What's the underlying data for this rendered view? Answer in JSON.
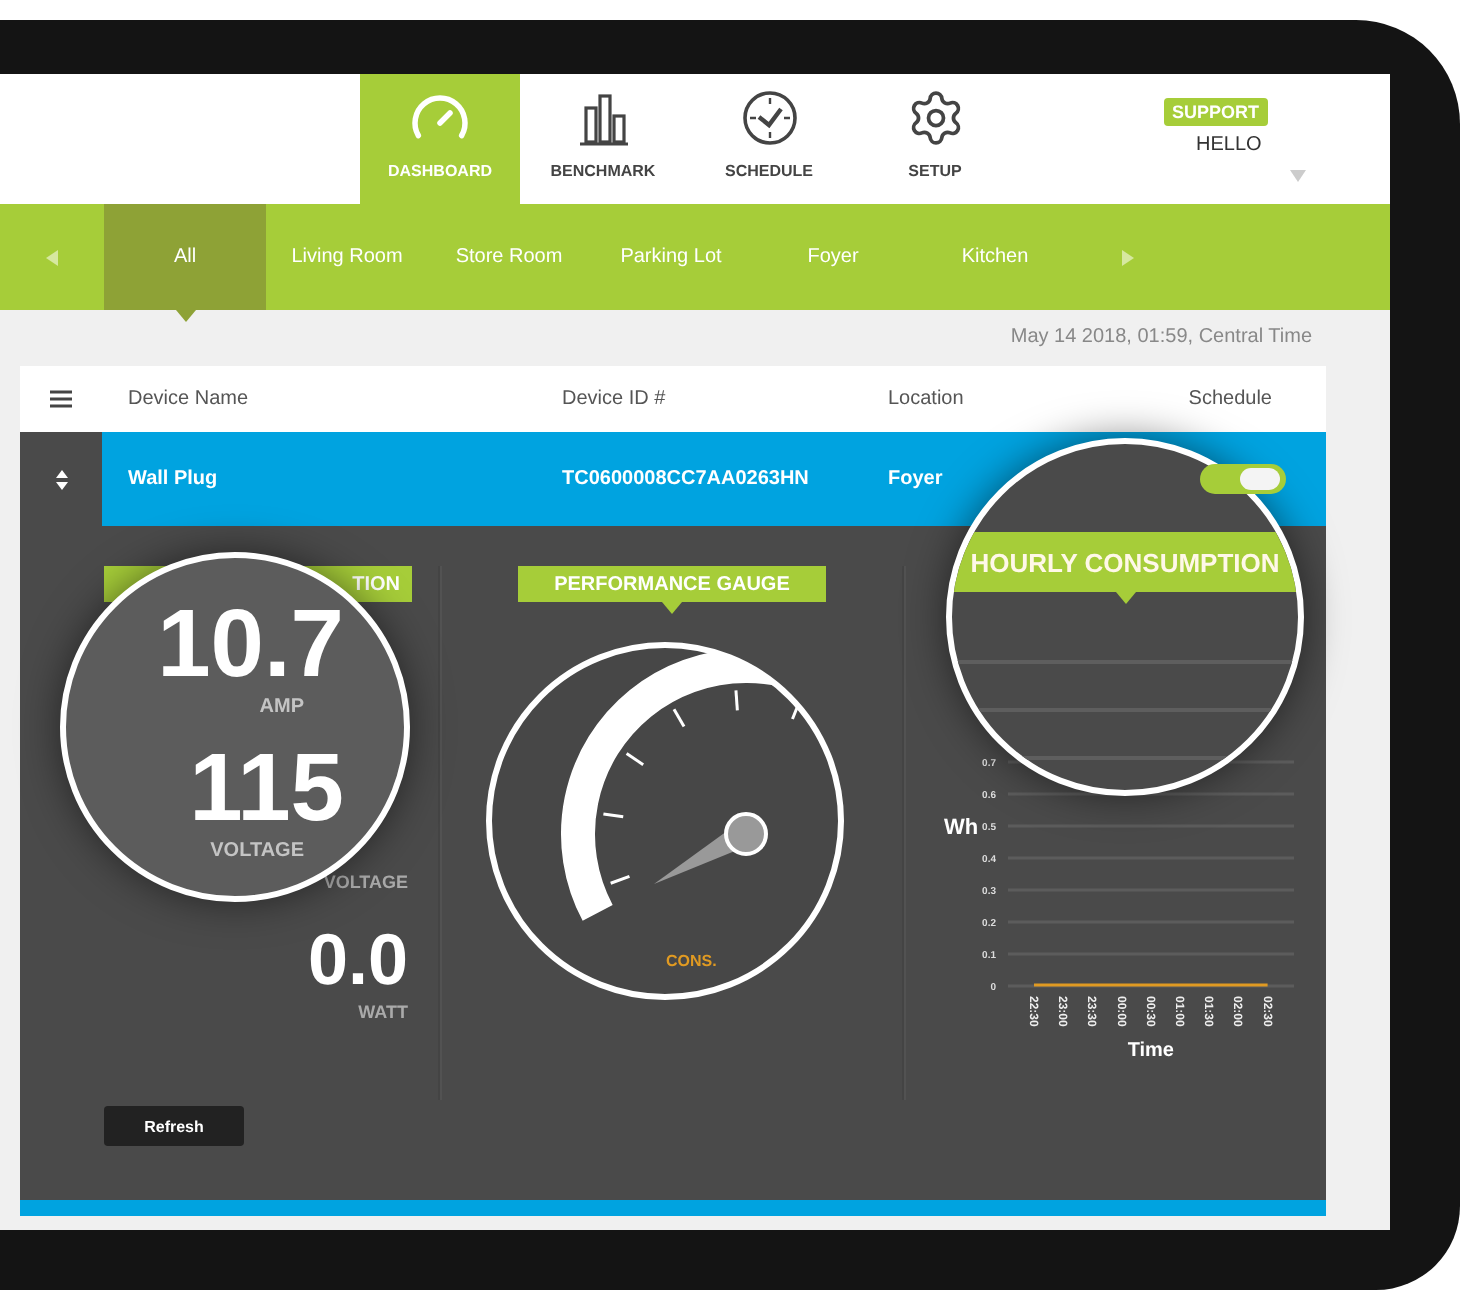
{
  "header": {
    "nav": [
      {
        "label": "DASHBOARD",
        "kind": "gauge",
        "selected": true
      },
      {
        "label": "BENCHMARK",
        "kind": "bars",
        "selected": false
      },
      {
        "label": "SCHEDULE",
        "kind": "clock",
        "selected": false
      },
      {
        "label": "SETUP",
        "kind": "gear",
        "selected": false
      }
    ],
    "support_badge": "SUPPORT",
    "greeting": "HELLO"
  },
  "rooms": [
    {
      "label": "All",
      "selected": true
    },
    {
      "label": "Living Room",
      "selected": false
    },
    {
      "label": "Store Room",
      "selected": false
    },
    {
      "label": "Parking Lot",
      "selected": false
    },
    {
      "label": "Foyer",
      "selected": false
    },
    {
      "label": "Kitchen",
      "selected": false
    }
  ],
  "timestamp": "May 14 2018, 01:59, Central Time",
  "table": {
    "columns": [
      "Device Name",
      "Device ID #",
      "Location",
      "Schedule"
    ],
    "rows": [
      {
        "device_name": "Wall Plug",
        "device_id": "TC0600008CC7AA0263HN",
        "location": "Foyer",
        "schedule_on": true
      }
    ]
  },
  "power_panel": {
    "title": "TION",
    "voltage_label": "VOLTAGE",
    "watt_value": "0.0",
    "watt_label": "WATT",
    "refresh_button": "Refresh",
    "lens": {
      "readings": [
        {
          "value": "10.7",
          "unit": "AMP"
        },
        {
          "value": "115",
          "unit": "VOLTAGE"
        }
      ]
    }
  },
  "gauge_panel": {
    "title": "PERFORMANCE GAUGE",
    "lens": {
      "label": "CONS."
    }
  },
  "consumption_panel": {
    "lens": {
      "title": "HOURLY CONSUMPTION"
    },
    "chart_data": {
      "type": "line",
      "xlabel": "Time",
      "ylabel": "Wh",
      "categories": [
        "22:30",
        "23:00",
        "23:30",
        "00:00",
        "00:30",
        "01:00",
        "01:30",
        "02:00",
        "02:30"
      ],
      "series": [
        {
          "color": "#e09a22",
          "values": [
            0,
            0,
            0,
            0,
            0,
            0,
            0,
            0,
            0
          ]
        }
      ],
      "yticks": [
        0,
        0.1,
        0.2,
        0.3,
        0.4,
        0.5,
        0.6,
        0.7
      ],
      "ylim": [
        0,
        0.7
      ],
      "grid": true
    }
  }
}
